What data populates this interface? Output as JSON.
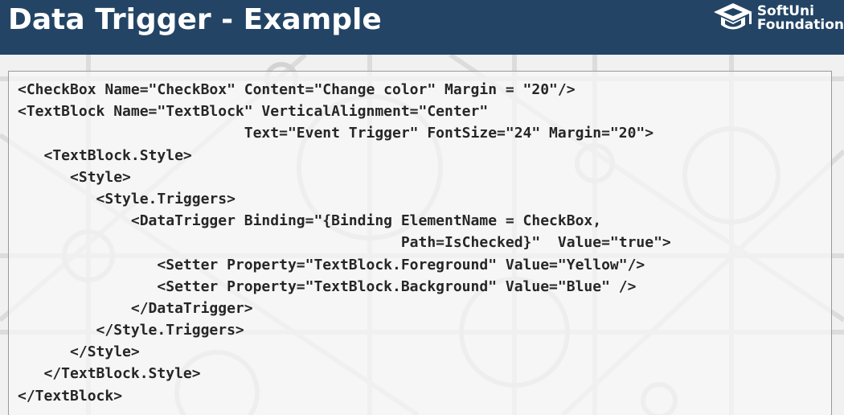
{
  "header": {
    "title": "Data Trigger - Example",
    "background_color": "#234465",
    "logo": {
      "icon": "graduation-cap-icon",
      "line1": "SoftUni",
      "line2": "Foundation"
    }
  },
  "slide": {
    "background_color": "#f1f1f1",
    "code_lines": [
      "<CheckBox Name=\"CheckBox\" Content=\"Change color\" Margin = \"20\"/>",
      "<TextBlock Name=\"TextBlock\" VerticalAlignment=\"Center\"",
      "                          Text=\"Event Trigger\" FontSize=\"24\" Margin=\"20\">",
      "   <TextBlock.Style>",
      "      <Style>",
      "         <Style.Triggers>",
      "             <DataTrigger Binding=\"{Binding ElementName = CheckBox,",
      "                                            Path=IsChecked}\"  Value=\"true\">",
      "                <Setter Property=\"TextBlock.Foreground\" Value=\"Yellow\"/>",
      "                <Setter Property=\"TextBlock.Background\" Value=\"Blue\" />",
      "             </DataTrigger>",
      "         </Style.Triggers>",
      "      </Style>",
      "   </TextBlock.Style>",
      "</TextBlock>"
    ]
  }
}
